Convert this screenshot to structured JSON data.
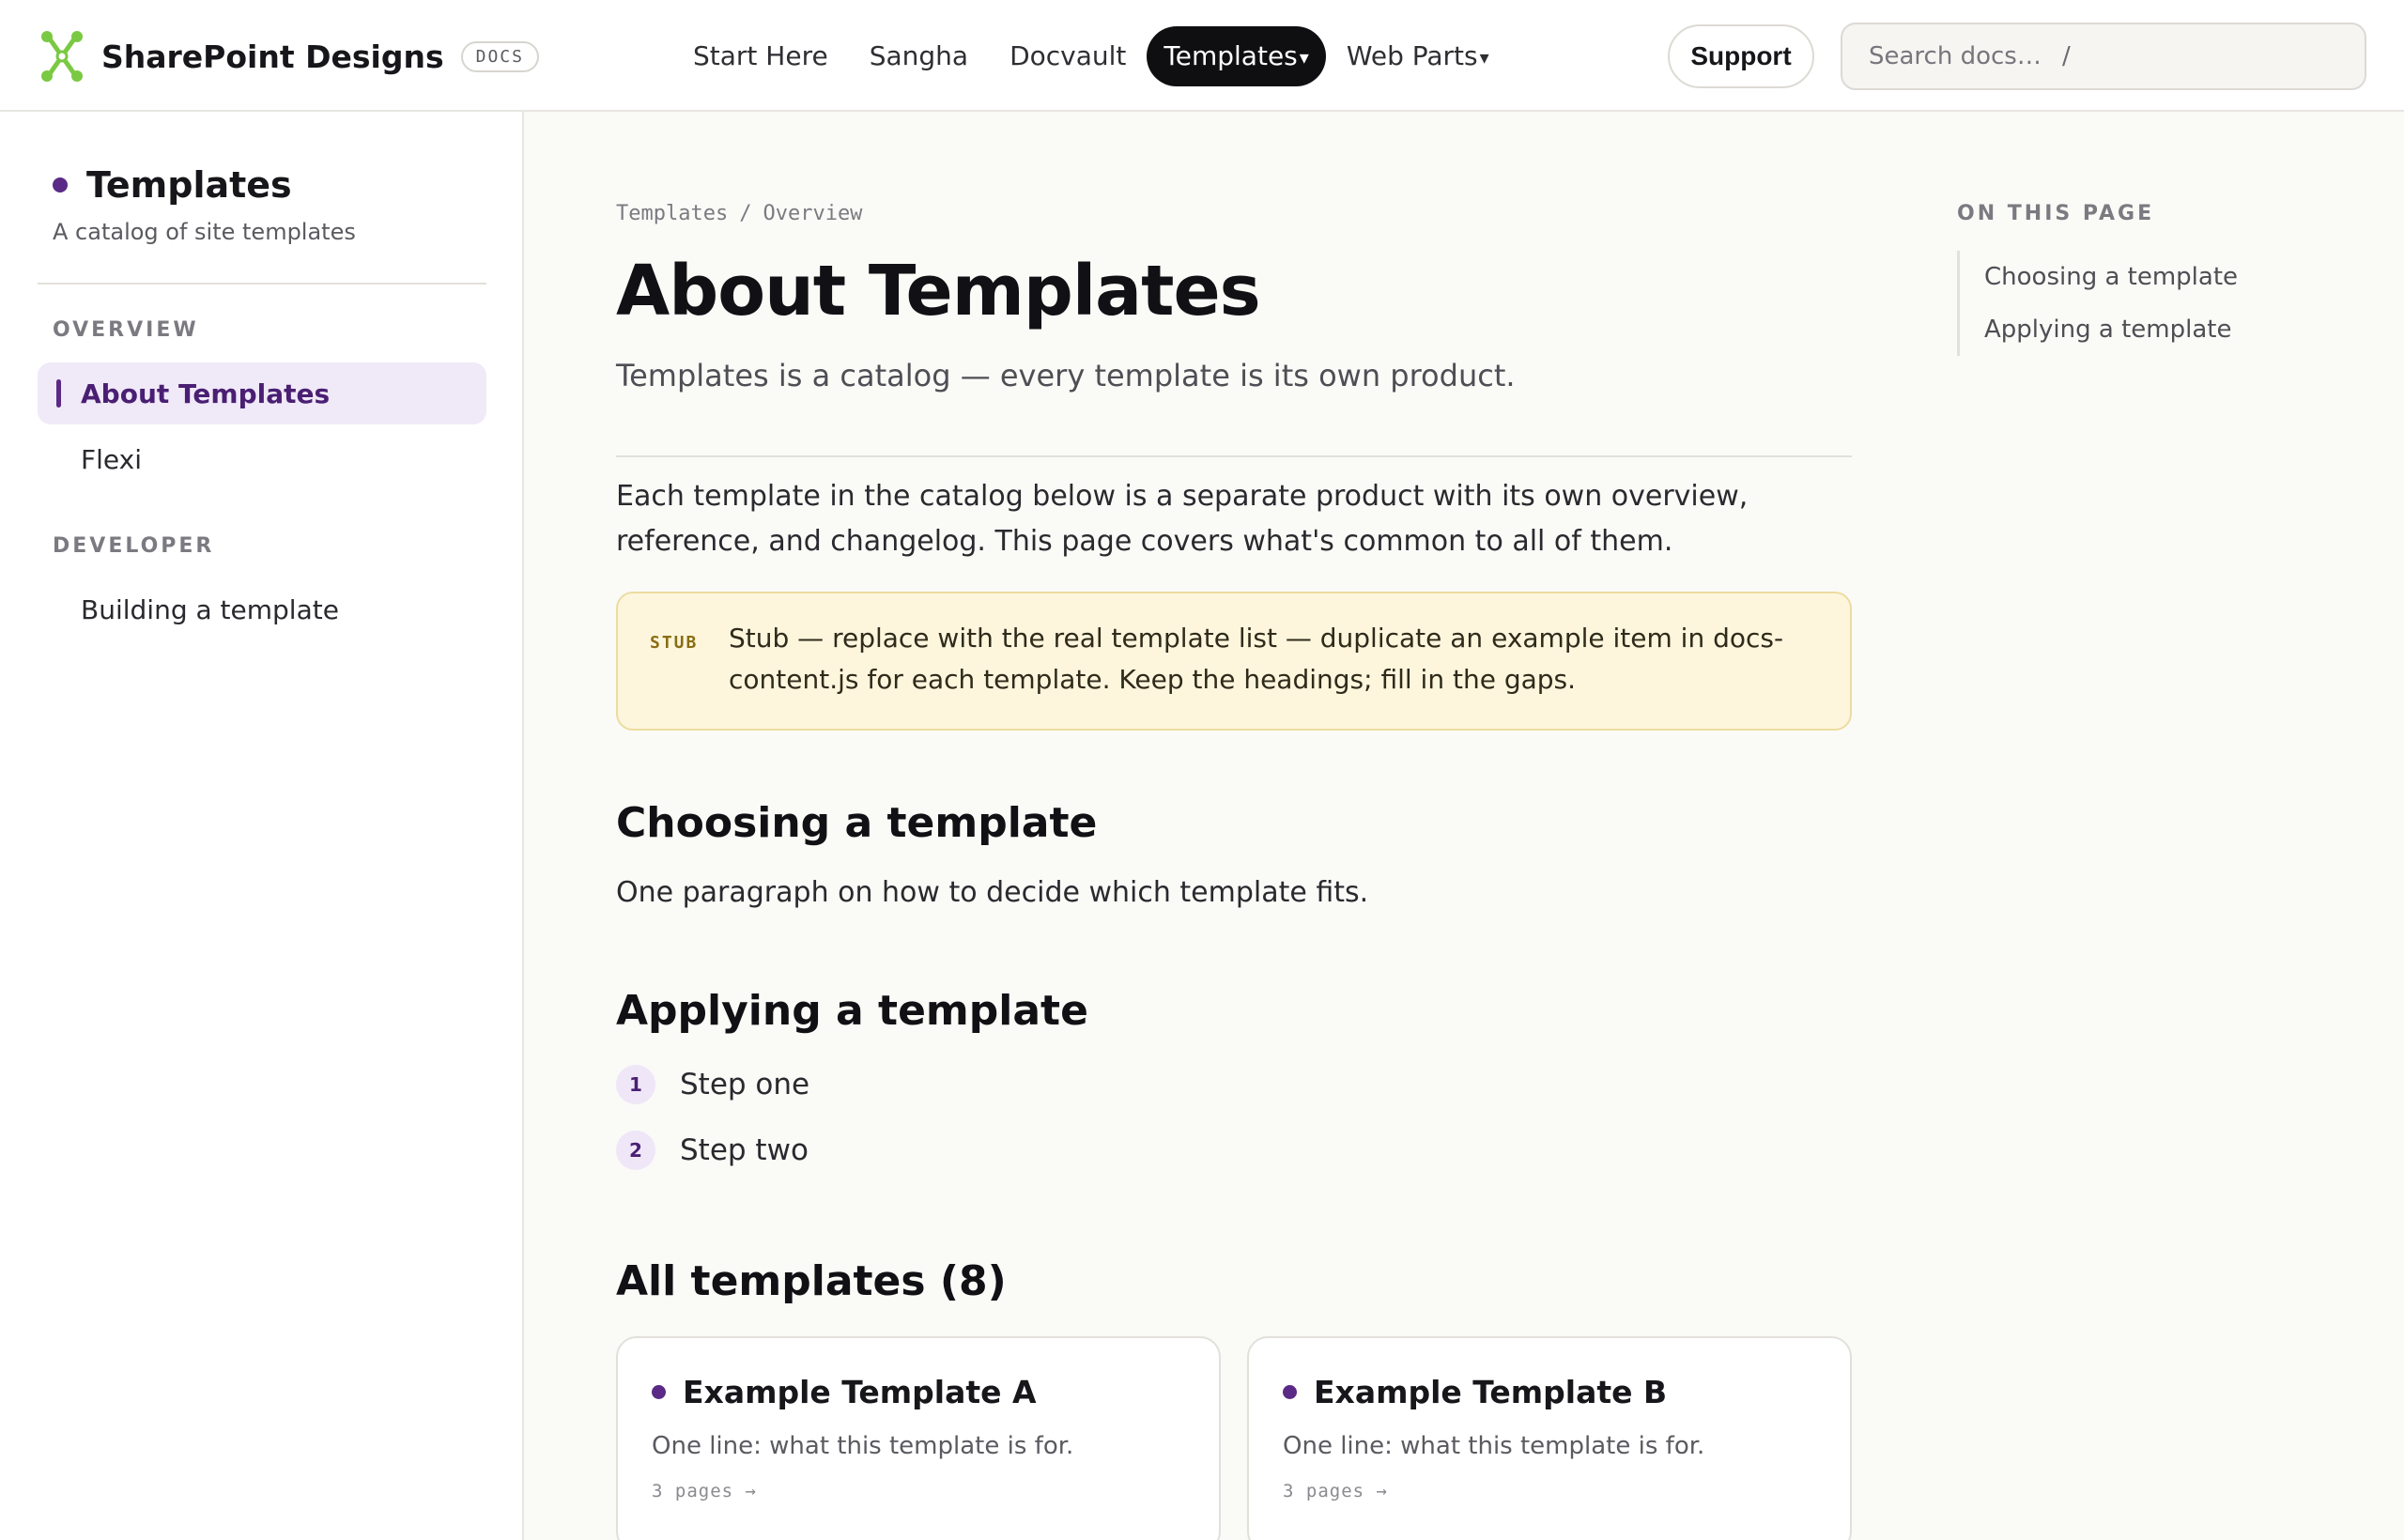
{
  "header": {
    "brand_name": "SharePoint Designs",
    "docs_badge": "DOCS",
    "nav": [
      {
        "label": "Start Here"
      },
      {
        "label": "Sangha"
      },
      {
        "label": "Docvault"
      },
      {
        "label": "Templates",
        "caret": "▾",
        "active": true
      },
      {
        "label": "Web Parts",
        "caret": "▾"
      }
    ],
    "support_label": "Support",
    "search": {
      "placeholder": "Search docs…",
      "shortcut": "/"
    }
  },
  "sidebar": {
    "title": "Templates",
    "subtitle": "A catalog of site templates",
    "groups": [
      {
        "label": "OVERVIEW",
        "items": [
          "About Templates",
          "Flexi"
        ]
      },
      {
        "label": "DEVELOPER",
        "items": [
          "Building a template"
        ]
      }
    ],
    "active_item": "About Templates"
  },
  "main": {
    "breadcrumb": [
      "Templates",
      "Overview"
    ],
    "breadcrumb_sep": "/",
    "title": "About Templates",
    "lede": "Templates is a catalog — every template is its own product.",
    "intro": "Each template in the catalog below is a separate product with its own overview, reference, and changelog. This page covers what's common to all of them.",
    "stub": {
      "tag": "STUB",
      "text": "Stub — replace with the real template list — duplicate an example item in docs-content.js for each template. Keep the headings; fill in the gaps."
    },
    "choosing": {
      "heading": "Choosing a template",
      "body": "One paragraph on how to decide which template fits."
    },
    "applying": {
      "heading": "Applying a template",
      "steps": [
        {
          "num": "1",
          "label": "Step one"
        },
        {
          "num": "2",
          "label": "Step two"
        }
      ]
    },
    "all_templates": {
      "heading": "All templates (8)",
      "cards": [
        {
          "title": "Example Template A",
          "desc": "One line: what this template is for.",
          "meta": "3 pages →"
        },
        {
          "title": "Example Template B",
          "desc": "One line: what this template is for.",
          "meta": "3 pages →"
        }
      ]
    }
  },
  "toc": {
    "heading": "ON THIS PAGE",
    "items": [
      "Choosing a template",
      "Applying a template"
    ]
  },
  "colors": {
    "accent": "#5b2a86",
    "logo": "#7ac943",
    "active_nav_bg": "#0f0f12",
    "stub_bg": "#fdf6dd"
  }
}
